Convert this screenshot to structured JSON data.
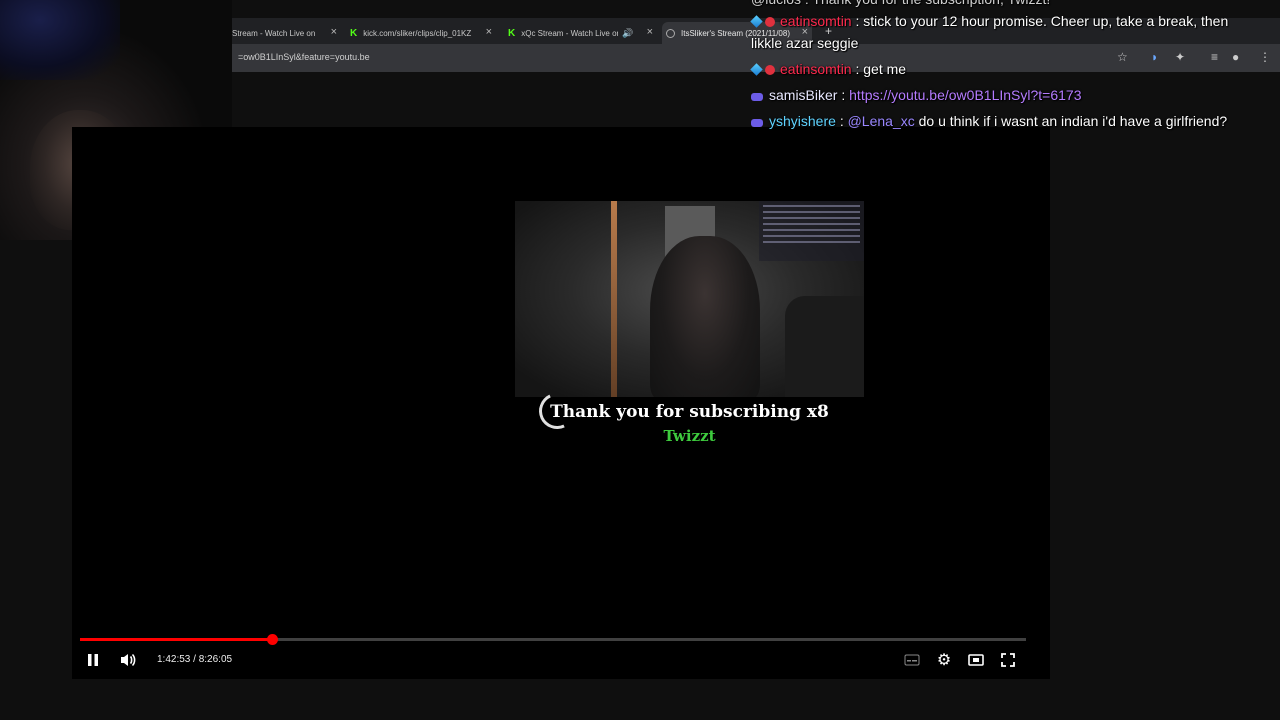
{
  "browser": {
    "tabs": [
      {
        "label": "Stream - Watch Live on K",
        "icon": "kick-icon"
      },
      {
        "label": "kick.com/sliker/clips/clip_01KZ",
        "icon": "kick-icon"
      },
      {
        "label": "xQc Stream - Watch Live on",
        "icon": "kick-icon"
      },
      {
        "label": "ItsSliker's Stream (2021/11/08)",
        "icon": "globe-icon"
      }
    ],
    "url": "=ow0B1LInSyl&feature=youtu.be"
  },
  "player": {
    "alert_title": "Thank you for subscribing x8",
    "alert_name": "Twizzt",
    "current_time": "1:42:53",
    "duration": "8:26:05",
    "time_display": "1:42:53 / 8:26:05",
    "progress_fraction": 0.2033,
    "progress_color": "#ff0000"
  },
  "chat": {
    "partial_top": "@luclos : Thank you for the subscription, Twizzt!",
    "messages": [
      {
        "user": "eatinsomtin",
        "text": "stick to your 12 hour promise. Cheer up, take a break, then",
        "color": "#ff2a4d"
      },
      {
        "continuation": "likkle azar seggie"
      },
      {
        "user": "eatinsomtin",
        "text": "get me",
        "color": "#ff2a4d"
      },
      {
        "user": "samisBiker",
        "text": "https://youtu.be/ow0B1LInSyl?t=6173",
        "color": "#e8e8ff"
      },
      {
        "user": "yshyishere",
        "mention": "@Lena_xc",
        "text": "do u think if i wasnt an indian i'd have a girlfriend?",
        "color": "#5fd3ff"
      }
    ],
    "separator": ":"
  }
}
